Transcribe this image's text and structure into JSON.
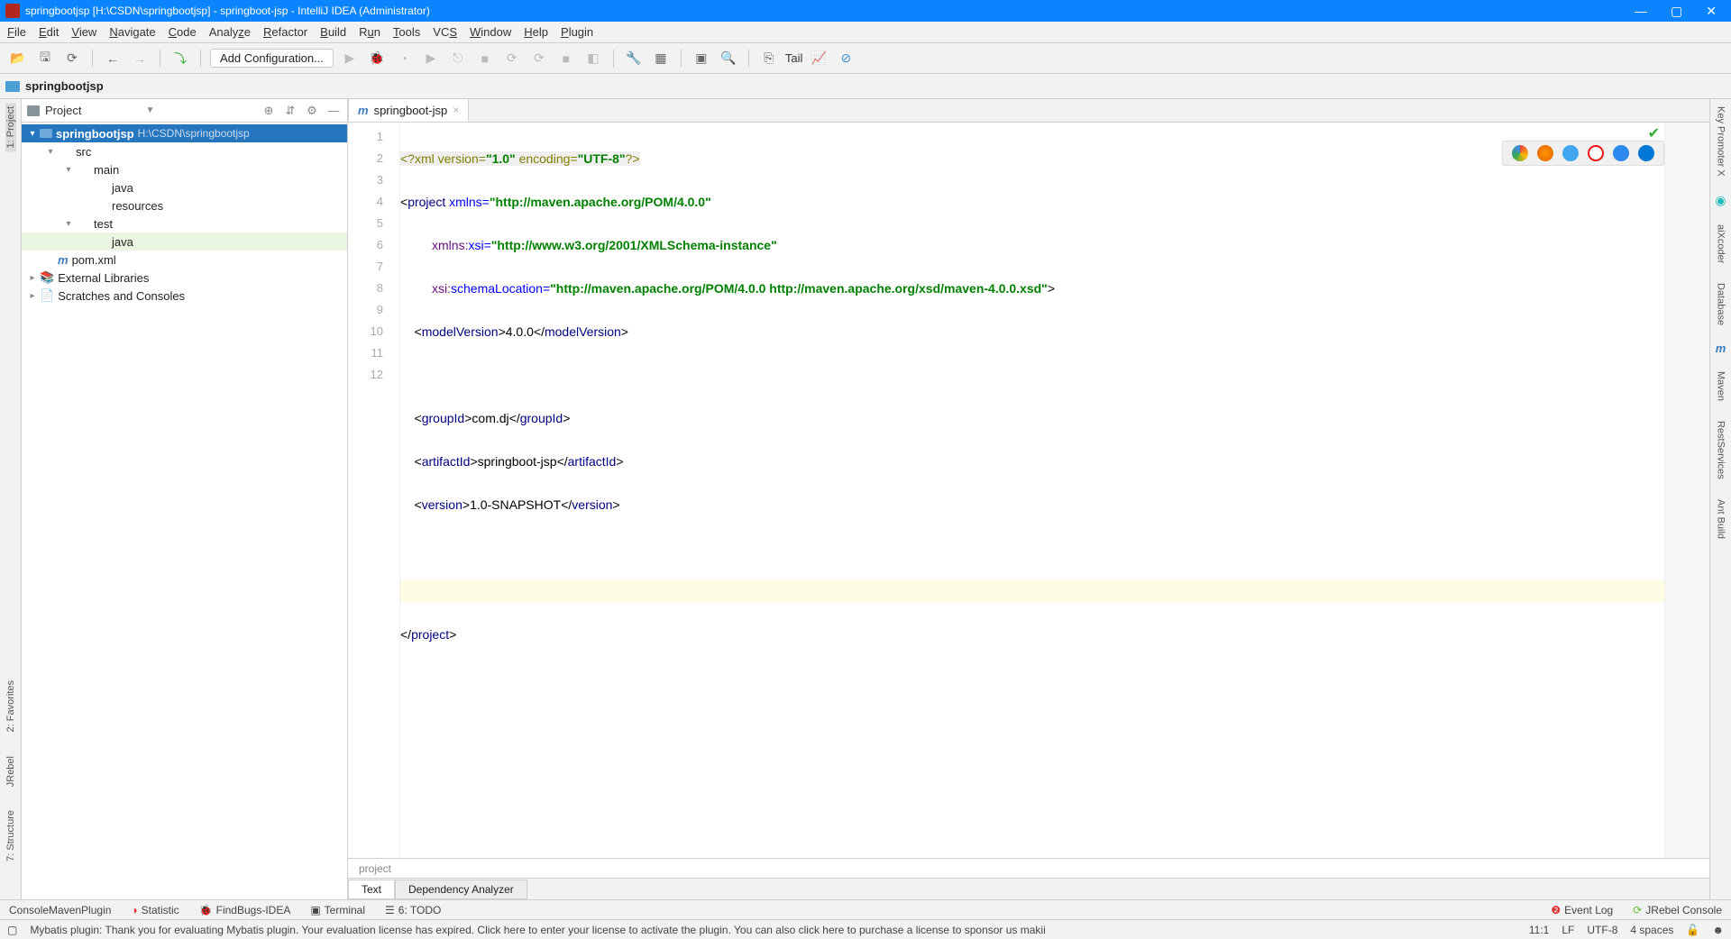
{
  "title": "springbootjsp [H:\\CSDN\\springbootjsp] - springboot-jsp - IntelliJ IDEA (Administrator)",
  "menu": [
    "File",
    "Edit",
    "View",
    "Navigate",
    "Code",
    "Analyze",
    "Refactor",
    "Build",
    "Run",
    "Tools",
    "VCS",
    "Window",
    "Help",
    "Plugin"
  ],
  "toolbar": {
    "add_config": "Add Configuration...",
    "tail": "Tail"
  },
  "breadcrumb": {
    "root": "springbootjsp"
  },
  "left_strip": [
    "1: Project",
    "2: Favorites",
    "7: Structure",
    "JRebel"
  ],
  "right_strip": [
    "Key Promoter X",
    "aiXcoder",
    "Database",
    "Maven",
    "RestServices",
    "Ant Build"
  ],
  "project_panel": {
    "title": "Project",
    "tree": {
      "root": {
        "name": "springbootjsp",
        "path": "H:\\CSDN\\springbootjsp"
      },
      "src": "src",
      "main": "main",
      "java_main": "java",
      "resources": "resources",
      "test": "test",
      "java_test": "java",
      "pom": "pom.xml",
      "ext_lib": "External Libraries",
      "scratches": "Scratches and Consoles"
    }
  },
  "editor": {
    "tab": "springboot-jsp",
    "breadcrumb_footer": "project",
    "bottom_tabs": [
      "Text",
      "Dependency Analyzer"
    ],
    "lines": [
      "1",
      "2",
      "3",
      "4",
      "5",
      "6",
      "7",
      "8",
      "9",
      "10",
      "11",
      "12"
    ],
    "current_line_index": 10
  },
  "code": {
    "l1_a": "<?xml version=",
    "l1_b": "\"1.0\"",
    "l1_c": " encoding=",
    "l1_d": "\"UTF-8\"",
    "l1_e": "?>",
    "l2_a": "<",
    "l2_tag": "project",
    "l2_attr": " xmlns=",
    "l2_val": "\"http://maven.apache.org/POM/4.0.0\"",
    "l3_pre": "         ",
    "l3_ns": "xmlns:",
    "l3_attr": "xsi=",
    "l3_val": "\"http://www.w3.org/2001/XMLSchema-instance\"",
    "l4_pre": "         ",
    "l4_ns": "xsi:",
    "l4_attr": "schemaLocation=",
    "l4_val": "\"http://maven.apache.org/POM/4.0.0 http://maven.apache.org/xsd/maven-4.0.0.xsd\"",
    "l4_close": ">",
    "l5_a": "    <",
    "l5_tag": "modelVersion",
    "l5_b": ">",
    "l5_txt": "4.0.0",
    "l5_c": "</",
    "l5_d": ">",
    "l7_a": "    <",
    "l7_tag": "groupId",
    "l7_b": ">",
    "l7_txt": "com.dj",
    "l7_c": "</",
    "l7_d": ">",
    "l8_a": "    <",
    "l8_tag": "artifactId",
    "l8_b": ">",
    "l8_txt": "springboot-jsp",
    "l8_c": "</",
    "l8_d": ">",
    "l9_a": "    <",
    "l9_tag": "version",
    "l9_b": ">",
    "l9_txt": "1.0-SNAPSHOT",
    "l9_c": "</",
    "l9_d": ">",
    "l12_a": "</",
    "l12_tag": "project",
    "l12_b": ">"
  },
  "toolwindows": {
    "left": [
      "ConsoleMavenPlugin",
      "Statistic",
      "FindBugs-IDEA",
      "Terminal",
      "6: TODO"
    ],
    "right": [
      "Event Log",
      "JRebel Console"
    ]
  },
  "status": {
    "msg": "Mybatis plugin: Thank you for evaluating Mybatis plugin. Your evaluation license has expired. Click here to enter your license to activate the plugin. You can also click here to purchase a license to sponsor us makii",
    "pos": "11:1",
    "le": "LF",
    "enc": "UTF-8",
    "indent": "4 spaces"
  }
}
